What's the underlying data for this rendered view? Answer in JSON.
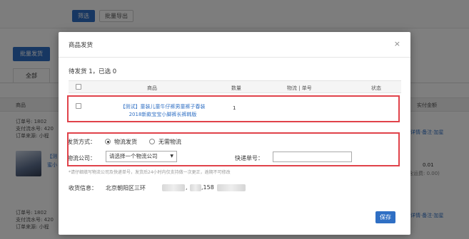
{
  "background": {
    "filter_label": "",
    "filter_button": "筛选",
    "export_button": "批量导出",
    "batch_ship_button": "批量发货",
    "tab_all": "全部",
    "header_goods": "商品",
    "header_paid": "实付金额",
    "orders": [
      {
        "order_no": "订单号: 1802",
        "pay_serial": "支付流水号: 420",
        "source": "订单来源: 小程"
      },
      {
        "order_no": "订单号: 1802",
        "pay_serial": "支付流水号: 420",
        "source": "订单来源: 小程"
      }
    ],
    "goods_snippet_line1": "【测",
    "goods_snippet_line2": "蜜小",
    "detail_link_1": "详情·备注·加星",
    "detail_link_2": "详情·备注·加星",
    "amount": "0.01",
    "amount_sub": "含运费: 0.00)"
  },
  "modal": {
    "title": "商品发货",
    "close": "×",
    "pending": "待发货 1，已选 0",
    "columns": {
      "goods": "商品",
      "qty": "数量",
      "logistics": "物流 | 单号",
      "status": "状态"
    },
    "item": {
      "title_line1": "【测试】童装儿童牛仔裤男童裤子春装",
      "title_line2": "2018新款宝宝小脚裤长裤韩版",
      "qty": "1"
    },
    "ship_method_label": "发货方式：",
    "ship_options": [
      "物流发货",
      "无需物流"
    ],
    "ship_selected": 0,
    "company_label": "物流公司：",
    "company_select": "请选择一个物流公司",
    "tracking_label": "快递单号：",
    "tracking_value": "",
    "hint": "*请仔细填写物流公司及快递单号，发货后24小时内仅支持做一次更正，逾期不可修改",
    "recv_label": "收货信息：",
    "recv_addr": "北京朝阳区三环",
    "recv_tail_1": ",",
    "recv_tail_2": ",158",
    "save": "保存"
  },
  "colors": {
    "accent": "#2f6fc4",
    "highlight": "#e0424a"
  }
}
